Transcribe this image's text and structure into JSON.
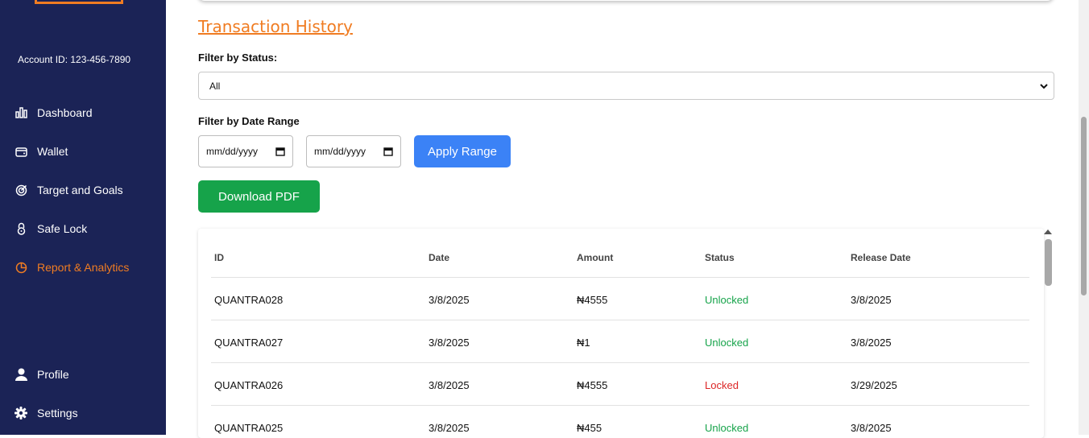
{
  "sidebar": {
    "account_id": "Account ID: 123-456-7890",
    "items": [
      {
        "label": "Dashboard",
        "icon": "bar-chart-icon"
      },
      {
        "label": "Wallet",
        "icon": "wallet-icon"
      },
      {
        "label": "Target and Goals",
        "icon": "target-icon"
      },
      {
        "label": "Safe Lock",
        "icon": "lock-icon"
      },
      {
        "label": "Report & Analytics",
        "icon": "pie-chart-icon",
        "active": true
      }
    ],
    "bottom_items": [
      {
        "label": "Profile",
        "icon": "user-icon"
      },
      {
        "label": "Settings",
        "icon": "gear-icon"
      }
    ]
  },
  "main": {
    "title": "Transaction History",
    "filter_status_label": "Filter by Status:",
    "filter_status_value": "All",
    "filter_date_label": "Filter by Date Range",
    "date_from_placeholder": "mm/dd/yyyy",
    "date_to_placeholder": "mm/dd/yyyy",
    "apply_label": "Apply Range",
    "download_label": "Download PDF"
  },
  "table": {
    "headers": [
      "ID",
      "Date",
      "Amount",
      "Status",
      "Release Date"
    ],
    "rows": [
      {
        "id": "QUANTRA028",
        "date": "3/8/2025",
        "amount": "₦4555",
        "status": "Unlocked",
        "release": "3/8/2025"
      },
      {
        "id": "QUANTRA027",
        "date": "3/8/2025",
        "amount": "₦1",
        "status": "Unlocked",
        "release": "3/8/2025"
      },
      {
        "id": "QUANTRA026",
        "date": "3/8/2025",
        "amount": "₦4555",
        "status": "Locked",
        "release": "3/29/2025"
      },
      {
        "id": "QUANTRA025",
        "date": "3/8/2025",
        "amount": "₦455",
        "status": "Unlocked",
        "release": "3/8/2025"
      }
    ]
  },
  "colors": {
    "sidebar_bg": "#1b2356",
    "accent": "#f07c22",
    "apply_button": "#3b82f6",
    "download_button": "#16a34a",
    "unlocked": "#16a34a",
    "locked": "#dc2626"
  }
}
